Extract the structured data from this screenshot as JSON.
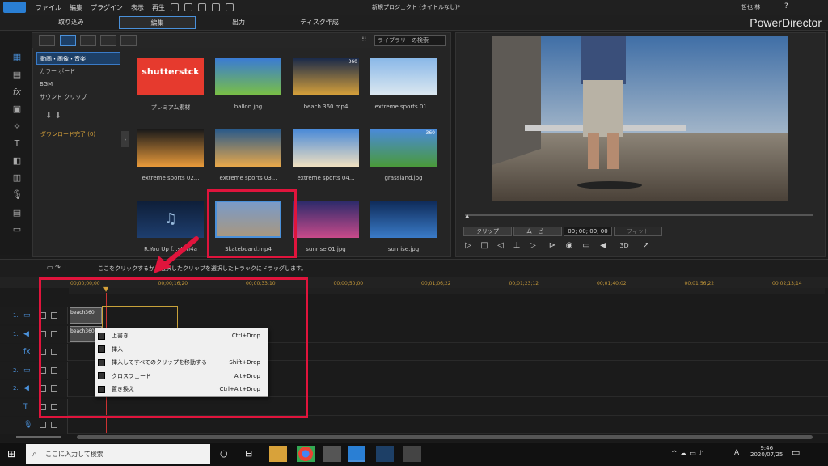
{
  "menu": {
    "items": [
      "ファイル",
      "編集",
      "プラグイン",
      "表示",
      "再生"
    ],
    "project_title": "新規プロジェクト (タイトルなし)*",
    "user": "哲也 林",
    "help": "?"
  },
  "modes": [
    "取り込み",
    "編集",
    "出力",
    "ディスク作成"
  ],
  "brand": "PowerDirector",
  "library": {
    "search_placeholder": "ライブラリーの検索",
    "categories": [
      "動画・画像・音楽",
      "カラー ボード",
      "BGM",
      "サウンド クリップ"
    ],
    "download_status": "ダウンロード完了 (0)",
    "items": [
      {
        "caption": "プレミアム素材",
        "kind": "shutterstock",
        "label": "shutterstck"
      },
      {
        "caption": "ballon.jpg"
      },
      {
        "caption": "beach 360.mp4",
        "badge": "360"
      },
      {
        "caption": "extreme sports 01..."
      },
      {
        "caption": "extreme sports 02..."
      },
      {
        "caption": "extreme sports 03..."
      },
      {
        "caption": "extreme sports 04..."
      },
      {
        "caption": "grassland.jpg",
        "badge": "360"
      },
      {
        "caption": "R.You Up f...st.m4a"
      },
      {
        "caption": "Skateboard.mp4"
      },
      {
        "caption": "sunrise 01.jpg"
      },
      {
        "caption": "sunrise.jpg"
      }
    ]
  },
  "player": {
    "tab_clip": "クリップ",
    "tab_movie": "ムービー",
    "timecode": "00; 00; 00; 00",
    "fit": "フィット",
    "mode3d": "3D"
  },
  "timeline": {
    "hint": "ここをクリックするか、選択したクリップを選択したトラックにドラッグします。",
    "marks": [
      "00;00;00;00",
      "00;00;16;20",
      "00;00;33;10",
      "00;00;50;00",
      "00;01;06;22",
      "00;01;23;12",
      "00;01;40;02",
      "00;01;56;22",
      "00;02;13;14"
    ],
    "tracks": [
      "1.",
      "1.",
      "",
      "2.",
      "2.",
      "",
      ""
    ],
    "clip_label": "beach360"
  },
  "context_menu": [
    {
      "label": "上書き",
      "key": "Ctrl+Drop"
    },
    {
      "label": "挿入",
      "key": ""
    },
    {
      "label": "挿入してすべてのクリップを移動する",
      "key": "Shift+Drop"
    },
    {
      "label": "クロスフェード",
      "key": "Alt+Drop"
    },
    {
      "label": "置き換え",
      "key": "Ctrl+Alt+Drop"
    }
  ],
  "taskbar": {
    "search": "ここに入力して検索",
    "time": "9:46",
    "date": "2020/07/25",
    "ime": "A"
  },
  "colors": {
    "accent": "#4a90d9",
    "highlight": "#e0143c"
  }
}
